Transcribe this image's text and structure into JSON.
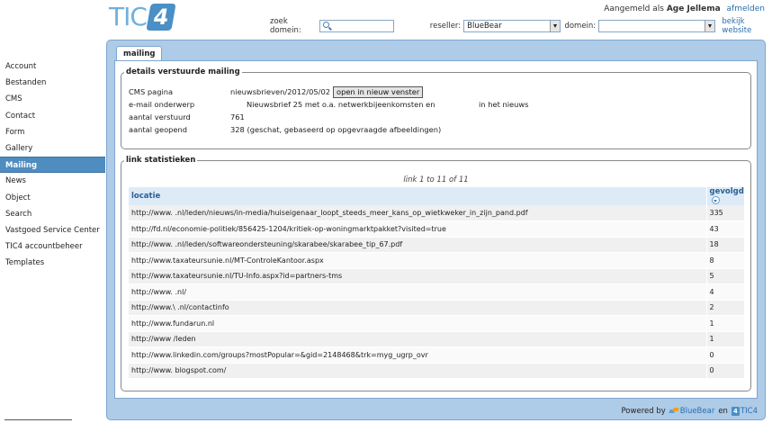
{
  "header": {
    "logo_text": "TIC",
    "logo_box": "4",
    "login_prefix": "Aangemeld als",
    "login_user": "Age Jellema",
    "logout_label": "afmelden",
    "search_label": "zoek domein:",
    "search_value": "",
    "reseller_label": "reseller:",
    "reseller_value": "BlueBear",
    "domein_label": "domein:",
    "domein_value": "",
    "bekijk_label": "bekijk website"
  },
  "sidebar": {
    "items": [
      {
        "label": "Account"
      },
      {
        "label": "Bestanden"
      },
      {
        "label": "CMS"
      },
      {
        "label": "Contact"
      },
      {
        "label": "Form"
      },
      {
        "label": "Gallery"
      },
      {
        "label": "Mailing"
      },
      {
        "label": "News"
      },
      {
        "label": "Object"
      },
      {
        "label": "Search"
      },
      {
        "label": "Vastgoed Service Center"
      },
      {
        "label": "TIC4 accountbeheer"
      },
      {
        "label": "Templates"
      }
    ],
    "active_index": 6
  },
  "tab": {
    "label": "mailing"
  },
  "details": {
    "legend": "details verstuurde mailing",
    "cms_label": "CMS pagina",
    "cms_value": "nieuwsbrieven/2012/05/02",
    "open_button": "open in nieuw venster",
    "subject_label": "e-mail onderwerp",
    "subject_value": "Nieuwsbrief 25 met o.a. netwerkbijeenkomsten en",
    "subject_tail": "in het nieuws",
    "sent_label": "aantal verstuurd",
    "sent_value": "761",
    "opened_label": "aantal geopend",
    "opened_value": "328 (geschat, gebaseerd op opgevraagde afbeeldingen)"
  },
  "links": {
    "legend": "link statistieken",
    "pager": "link 1 to 11 of 11",
    "col_location": "locatie",
    "col_followed": "gevolgd",
    "rows": [
      {
        "url": "http://www.                    .nl/leden/nieuws/in-media/huiseigenaar_loopt_steeds_meer_kans_op_wietkweker_in_zijn_pand.pdf",
        "count": "335"
      },
      {
        "url": "http://fd.nl/economie-politiek/856425-1204/kritiek-op-woningmarktpakket?visited=true",
        "count": "43"
      },
      {
        "url": "http://www.                    .nl/leden/softwareondersteuning/skarabee/skarabee_tip_67.pdf",
        "count": "18"
      },
      {
        "url": "http://www.taxateursunie.nl/MT-ControleKantoor.aspx",
        "count": "8"
      },
      {
        "url": "http://www.taxateursunie.nl/TU-Info.aspx?id=partners-tms",
        "count": "5"
      },
      {
        "url": "http://www.                    .nl/",
        "count": "4"
      },
      {
        "url": "http://www.\\                   .nl/contactinfo",
        "count": "2"
      },
      {
        "url": "http://www.fundarun.nl",
        "count": "1"
      },
      {
        "url": "http://www                     /leden",
        "count": "1"
      },
      {
        "url": "http://www.linkedin.com/groups?mostPopular=&gid=2148468&trk=myg_ugrp_ovr",
        "count": "0"
      },
      {
        "url": "http://www.                    blogspot.com/",
        "count": "0"
      }
    ]
  },
  "footer": {
    "powered": "Powered by",
    "bluebear": "BlueBear",
    "en": "en",
    "tic4": "TIC4"
  }
}
